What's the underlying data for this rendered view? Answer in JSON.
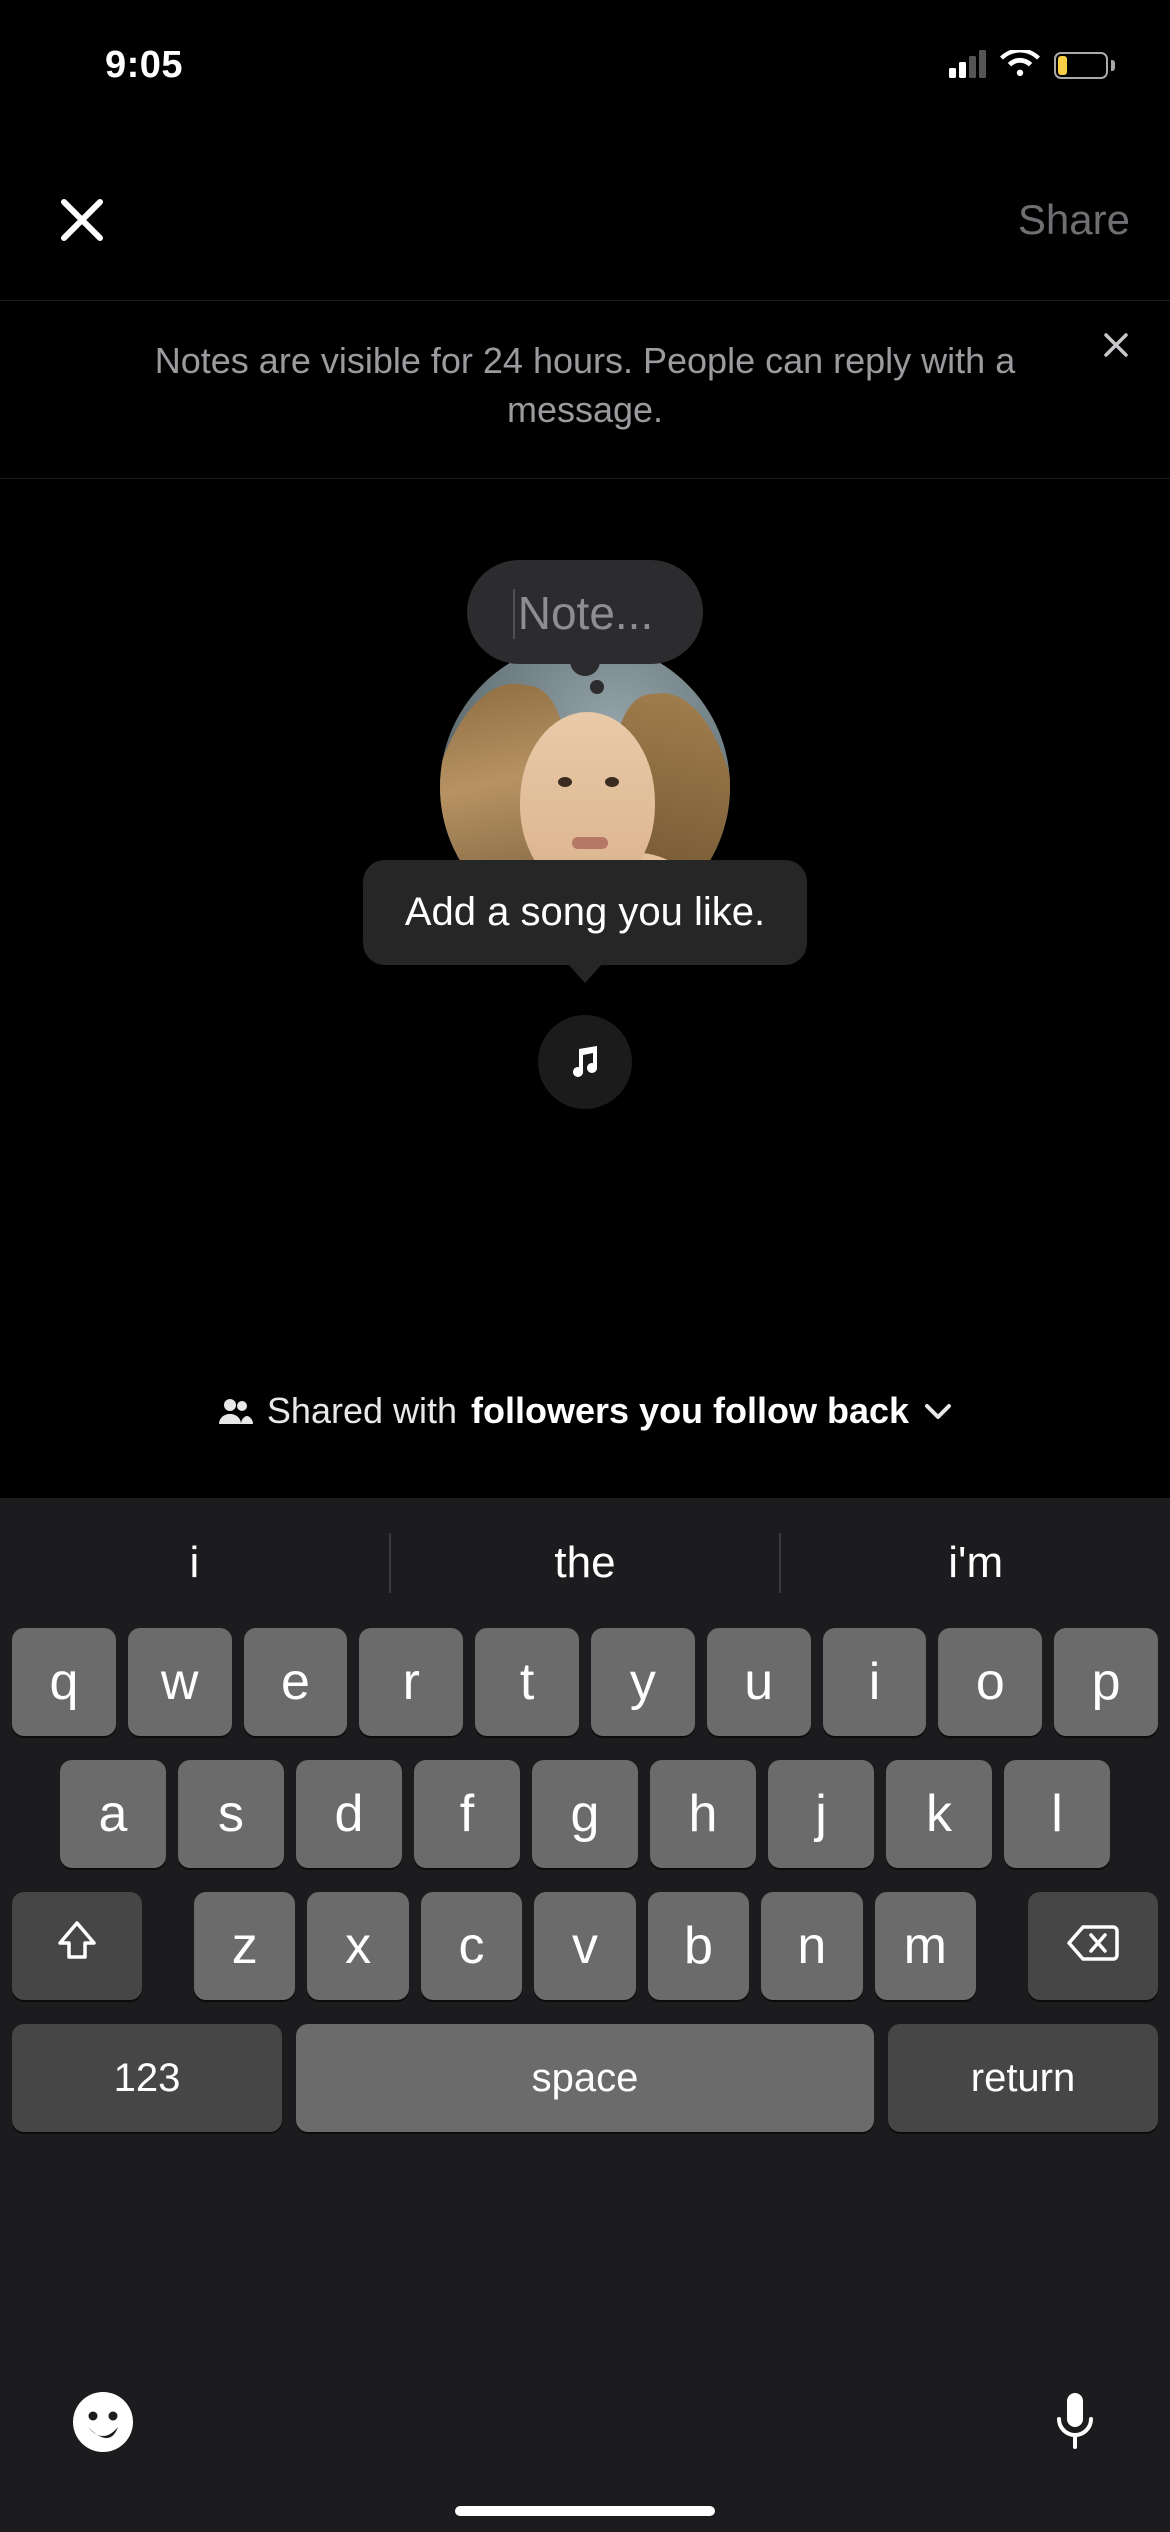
{
  "status": {
    "time": "9:05"
  },
  "header": {
    "share_label": "Share"
  },
  "banner": {
    "text": "Notes are visible for 24 hours. People can reply with a message."
  },
  "note": {
    "placeholder": "Note..."
  },
  "song_tooltip": "Add a song you like.",
  "audience": {
    "prefix": "Shared with ",
    "value": "followers you follow back"
  },
  "keyboard": {
    "suggestions": [
      "i",
      "the",
      "i'm"
    ],
    "row1": [
      "q",
      "w",
      "e",
      "r",
      "t",
      "y",
      "u",
      "i",
      "o",
      "p"
    ],
    "row2": [
      "a",
      "s",
      "d",
      "f",
      "g",
      "h",
      "j",
      "k",
      "l"
    ],
    "row3": [
      "z",
      "x",
      "c",
      "v",
      "b",
      "n",
      "m"
    ],
    "num_label": "123",
    "space_label": "space",
    "return_label": "return"
  }
}
